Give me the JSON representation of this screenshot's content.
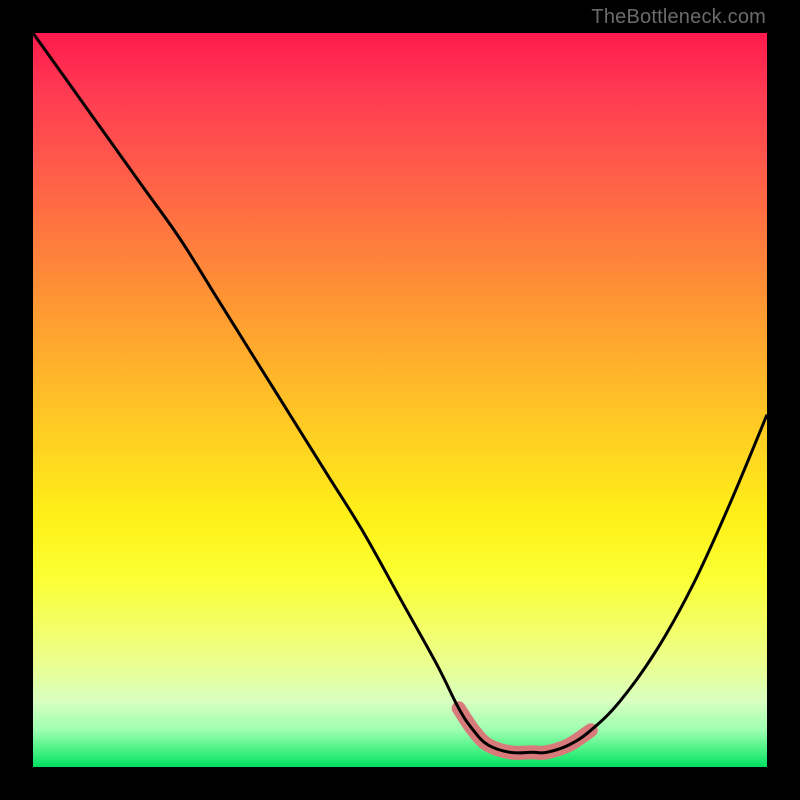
{
  "watermark": {
    "text": "TheBottleneck.com"
  },
  "colors": {
    "curve": "#000000",
    "valley_stroke": "#d87a7a",
    "background_black": "#000000"
  },
  "chart_data": {
    "type": "line",
    "title": "",
    "xlabel": "",
    "ylabel": "",
    "xlim": [
      0,
      100
    ],
    "ylim": [
      0,
      100
    ],
    "grid": false,
    "legend": false,
    "series": [
      {
        "name": "bottleneck-curve",
        "x": [
          0,
          5,
          10,
          15,
          20,
          25,
          30,
          35,
          40,
          45,
          50,
          55,
          58,
          60,
          62,
          65,
          68,
          70,
          73,
          76,
          80,
          85,
          90,
          95,
          100
        ],
        "y": [
          100,
          93,
          86,
          79,
          72,
          64,
          56,
          48,
          40,
          32,
          23,
          14,
          8,
          5,
          3,
          2,
          2,
          2,
          3,
          5,
          9,
          16,
          25,
          36,
          48
        ]
      }
    ],
    "annotations": [
      {
        "name": "valley-highlight",
        "x_range": [
          56,
          76
        ],
        "color": "#d87a7a"
      }
    ]
  }
}
